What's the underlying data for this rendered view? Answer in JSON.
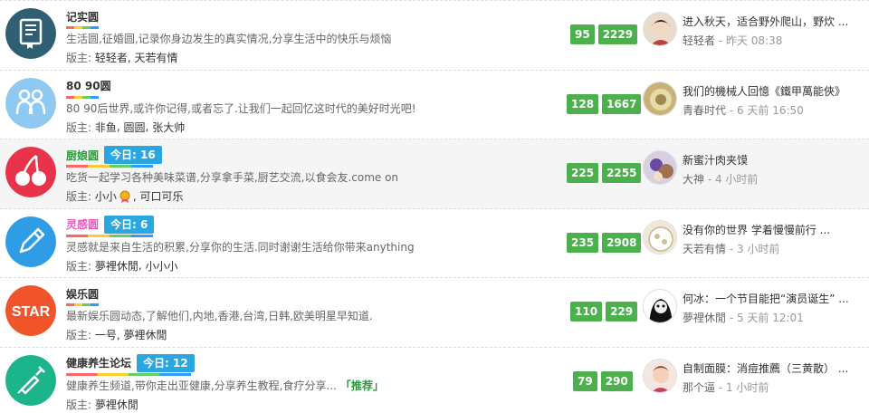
{
  "forums": [
    {
      "name": "记实圆",
      "description": "生活圆,征婚圆,记录你身边发生的真实情况,分享生活中的快乐与烦恼",
      "moderator_label": "版主:",
      "moderators": [
        "轻轻者",
        "天若有情"
      ],
      "stats": [
        "95",
        "2229"
      ],
      "last_post": {
        "title": "进入秋天，适合野外爬山，野炊 ...",
        "author": "轻轻者",
        "time": "昨天 08:38"
      },
      "icon": "book-icon",
      "colors": {
        "icon_bg": "#2f5f72"
      }
    },
    {
      "name": "80 90圆",
      "description": "80 90后世界,或许你记得,或者忘了.让我们一起回忆这时代的美好时光吧!",
      "moderator_label": "版主:",
      "moderators": [
        "非鱼",
        "圆圆",
        "张大帅"
      ],
      "stats": [
        "128",
        "1667"
      ],
      "last_post": {
        "title": "我们的機械人回憶《鐵甲萬能俠》",
        "author": "青春时代",
        "time": "6 天前 16:50"
      },
      "icon": "couple-icon",
      "colors": {
        "icon_bg": "#8fc8f0"
      }
    },
    {
      "name": "厨娘圆",
      "today_label": "今日: 16",
      "description": "吃货一起学习各种美味菜谱,分享拿手菜,厨艺交流,以食会友.come on",
      "moderator_label": "版主:",
      "moderators": [
        "小小",
        "可口可乐"
      ],
      "stats": [
        "225",
        "2255"
      ],
      "last_post": {
        "title": "新蜜汁肉夹馍",
        "author": "大神",
        "time": "4 小时前"
      },
      "icon": "cherry-icon",
      "colors": {
        "icon_bg": "#e8334a"
      }
    },
    {
      "name": "灵感圆",
      "today_label": "今日: 6",
      "description": "灵感就是来自生活的积累,分享你的生活.同时谢谢生活给你带来anything",
      "moderator_label": "版主:",
      "moderators": [
        "夢裡休閒",
        "小小小"
      ],
      "stats": [
        "235",
        "2908"
      ],
      "last_post": {
        "title": "没有你的世界 学着慢慢前行 ...",
        "author": "天若有情",
        "time": "3 小时前"
      },
      "icon": "pencil-icon",
      "colors": {
        "icon_bg": "#2e9de6"
      }
    },
    {
      "name": "娱乐圆",
      "description": "最新娱乐圆动态,了解他们,内地,香港,台湾,日韩,欧美明星早知道.",
      "moderator_label": "版主:",
      "moderators": [
        "一号",
        "夢裡休閒"
      ],
      "stats": [
        "110",
        "229"
      ],
      "last_post": {
        "title": "何冰：一个节目能把“演员诞生” ...",
        "author": "夢裡休閒",
        "time": "5 天前 12:01"
      },
      "icon": "star-text-icon",
      "icon_text": "STAR",
      "colors": {
        "icon_bg": "#f0542a"
      }
    },
    {
      "name": "健康养生论坛",
      "today_label": "今日: 12",
      "description": "健康养生频道,带你走出亚健康,分享养生教程,食疗分享...",
      "recommend": "「推荐」",
      "moderator_label": "版主:",
      "moderators": [
        "夢裡休閒"
      ],
      "stats": [
        "79",
        "290"
      ],
      "last_post": {
        "title": "自制面膜：消痘推薦（三黄散） ...",
        "author": "那个逼",
        "time": "1 小时前"
      },
      "icon": "syringe-icon",
      "colors": {
        "icon_bg": "#1cb48a"
      }
    }
  ],
  "colors": {
    "stat_badge": "#4cb04c",
    "today_badge": "#2aa6e0"
  }
}
